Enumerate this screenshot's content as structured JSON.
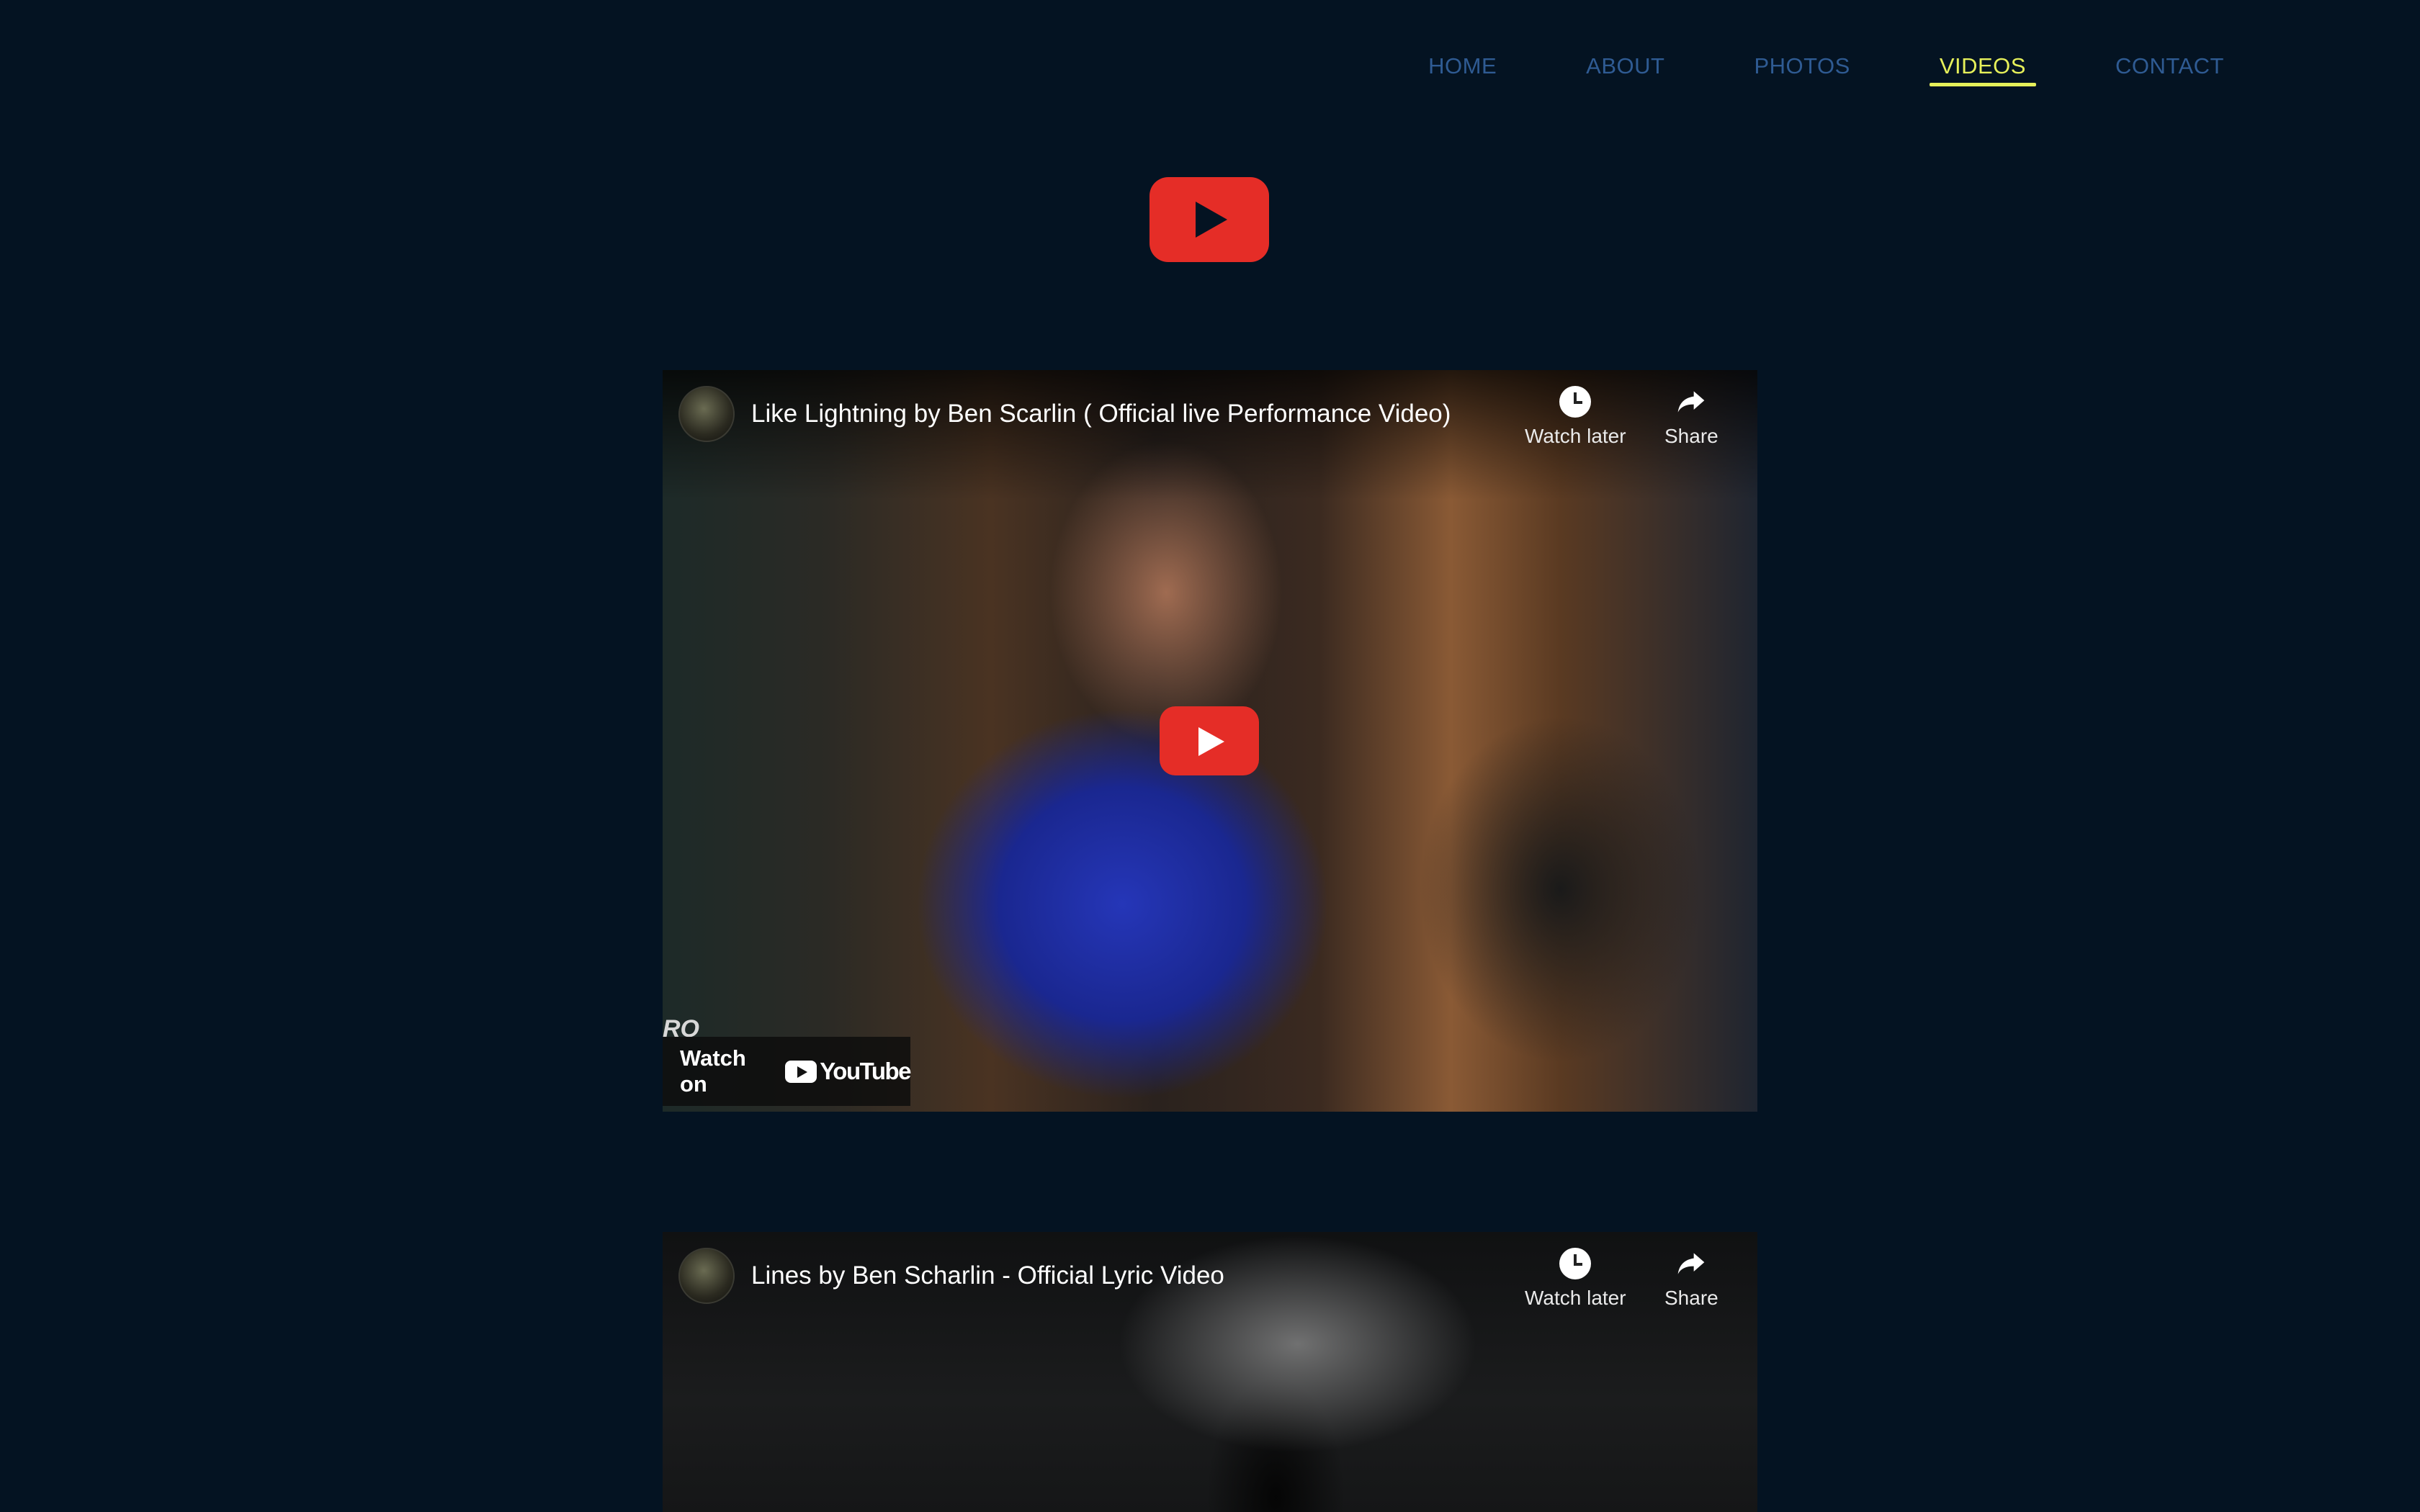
{
  "nav": {
    "items": [
      {
        "label": "HOME"
      },
      {
        "label": "ABOUT"
      },
      {
        "label": "PHOTOS"
      },
      {
        "label": "VIDEOS",
        "active": true
      },
      {
        "label": "CONTACT"
      }
    ]
  },
  "header_icon": "youtube-logo-icon",
  "videos": [
    {
      "title": "Like Lightning by Ben Scarlin ( Official live Performance Video)",
      "watch_later_label": "Watch later",
      "share_label": "Share",
      "watch_on_label": "Watch on",
      "youtube_wordmark": "YouTube",
      "scene_text": "RO"
    },
    {
      "title": "Lines by Ben Scharlin - Official Lyric Video",
      "watch_later_label": "Watch later",
      "share_label": "Share"
    }
  ],
  "colors": {
    "background": "#041322",
    "nav_link": "#2f5b93",
    "nav_active": "#e6f05a",
    "youtube_red": "#e52d27"
  }
}
